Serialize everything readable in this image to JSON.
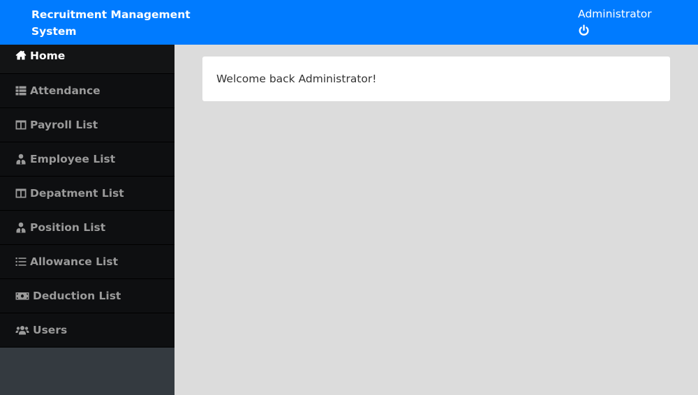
{
  "header": {
    "title": "Recruitment Management System",
    "user_name": "Administrator",
    "logout_icon": "power-icon"
  },
  "sidebar": {
    "items": [
      {
        "label": "Home",
        "icon": "home-icon",
        "active": true
      },
      {
        "label": "Attendance",
        "icon": "th-list-icon",
        "active": false
      },
      {
        "label": "Payroll List",
        "icon": "columns-icon",
        "active": false
      },
      {
        "label": "Employee List",
        "icon": "user-tie-icon",
        "active": false
      },
      {
        "label": "Depatment List",
        "icon": "columns-icon",
        "active": false
      },
      {
        "label": "Position List",
        "icon": "user-tie-icon",
        "active": false
      },
      {
        "label": "Allowance List",
        "icon": "list-icon",
        "active": false
      },
      {
        "label": "Deduction List",
        "icon": "money-bill-icon",
        "active": false
      },
      {
        "label": "Users",
        "icon": "users-icon",
        "active": false
      }
    ]
  },
  "main": {
    "welcome_message": "Welcome back Administrator!"
  },
  "colors": {
    "topbar": "#007bff",
    "sidebar_item_bg": "#0e0f11",
    "sidebar_bg": "#343a40",
    "content_bg": "#dcdcdc"
  }
}
